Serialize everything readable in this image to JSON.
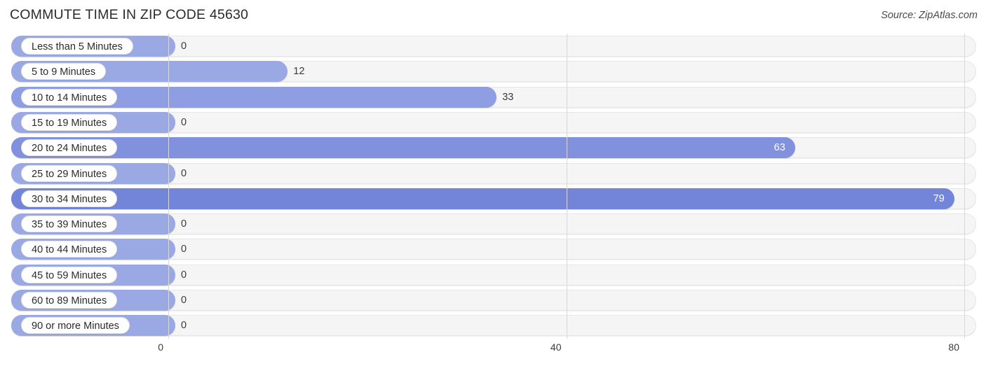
{
  "header": {
    "title": "COMMUTE TIME IN ZIP CODE 45630",
    "source": "Source: ZipAtlas.com"
  },
  "chart_data": {
    "type": "bar",
    "orientation": "horizontal",
    "title": "COMMUTE TIME IN ZIP CODE 45630",
    "subtitle": "Source: ZipAtlas.com",
    "xlabel": "",
    "ylabel": "",
    "xlim": [
      0,
      80
    ],
    "xticks": [
      0,
      40,
      80
    ],
    "xtick_labels": [
      "0",
      "40",
      "80"
    ],
    "grid": true,
    "legend": false,
    "categories": [
      "Less than 5 Minutes",
      "5 to 9 Minutes",
      "10 to 14 Minutes",
      "15 to 19 Minutes",
      "20 to 24 Minutes",
      "25 to 29 Minutes",
      "30 to 34 Minutes",
      "35 to 39 Minutes",
      "40 to 44 Minutes",
      "45 to 59 Minutes",
      "60 to 89 Minutes",
      "90 or more Minutes"
    ],
    "values": [
      0,
      12,
      33,
      0,
      63,
      0,
      79,
      0,
      0,
      0,
      0,
      0
    ],
    "value_labels": [
      "0",
      "12",
      "33",
      "0",
      "63",
      "0",
      "79",
      "0",
      "0",
      "0",
      "0",
      "0"
    ],
    "bar_color": "#9aa8e4",
    "bar_color_high": "#7385d8",
    "track_color": "#f5f5f5"
  }
}
